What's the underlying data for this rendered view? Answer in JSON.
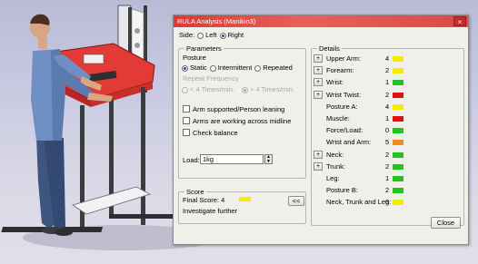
{
  "dialog": {
    "title": "RULA Analysis (Manikin3)",
    "close_glyph": "×"
  },
  "side": {
    "label": "Side:",
    "options": [
      "Left",
      "Right"
    ],
    "selected": "Right"
  },
  "parameters": {
    "group_label": "Parameters",
    "posture_label": "Posture",
    "posture_options": [
      "Static",
      "Intermittent",
      "Repeated"
    ],
    "posture_selected": "Static",
    "repeat_label": "Repeat Frequency",
    "repeat_options": [
      "< 4 Times/min.",
      "> 4 Times/min."
    ],
    "repeat_selected": "> 4 Times/min.",
    "checks": [
      {
        "label": "Arm supported/Person leaning",
        "checked": false
      },
      {
        "label": "Arms are working across midline",
        "checked": false
      },
      {
        "label": "Check balance",
        "checked": false
      }
    ],
    "load_label": "Load:",
    "load_value": "1kg"
  },
  "score": {
    "group_label": "Score",
    "final_label": "Final Score: 4",
    "final_color": "#f2ec00",
    "status": "Investigate further",
    "collapse_button": "<<"
  },
  "details": {
    "group_label": "Details",
    "rows": [
      {
        "label": "Upper Arm:",
        "value": "4",
        "color": "#f2ec00",
        "expandable": true
      },
      {
        "label": "Forearm:",
        "value": "2",
        "color": "#f2ec00",
        "expandable": true
      },
      {
        "label": "Wrist:",
        "value": "1",
        "color": "#22c322",
        "expandable": true
      },
      {
        "label": "Wrist Twist:",
        "value": "2",
        "color": "#dd1212",
        "expandable": true
      },
      {
        "label": "Posture A:",
        "value": "4",
        "color": "#f2ec00",
        "expandable": false
      },
      {
        "label": "Muscle:",
        "value": "1",
        "color": "#dd1212",
        "expandable": false
      },
      {
        "label": "Force/Load:",
        "value": "0",
        "color": "#22c322",
        "expandable": false
      },
      {
        "label": "Wrist and Arm:",
        "value": "5",
        "color": "#f08a1c",
        "expandable": false
      },
      {
        "label": "Neck:",
        "value": "2",
        "color": "#22c322",
        "expandable": true
      },
      {
        "label": "Trunk:",
        "value": "2",
        "color": "#22c322",
        "expandable": true
      },
      {
        "label": "Leg:",
        "value": "1",
        "color": "#22c322",
        "expandable": false
      },
      {
        "label": "Posture B:",
        "value": "2",
        "color": "#22c322",
        "expandable": false
      },
      {
        "label": "Neck, Trunk and Leg:",
        "value": "3",
        "color": "#f2ec00",
        "expandable": false
      }
    ],
    "expand_glyph": "+"
  },
  "footer": {
    "close_button": "Close"
  },
  "viewport": {
    "table_top_color": "#e23a34",
    "frame_color": "#3c3c40",
    "shirt_color": "#6e8fc4",
    "pants_color": "#3e557f"
  }
}
